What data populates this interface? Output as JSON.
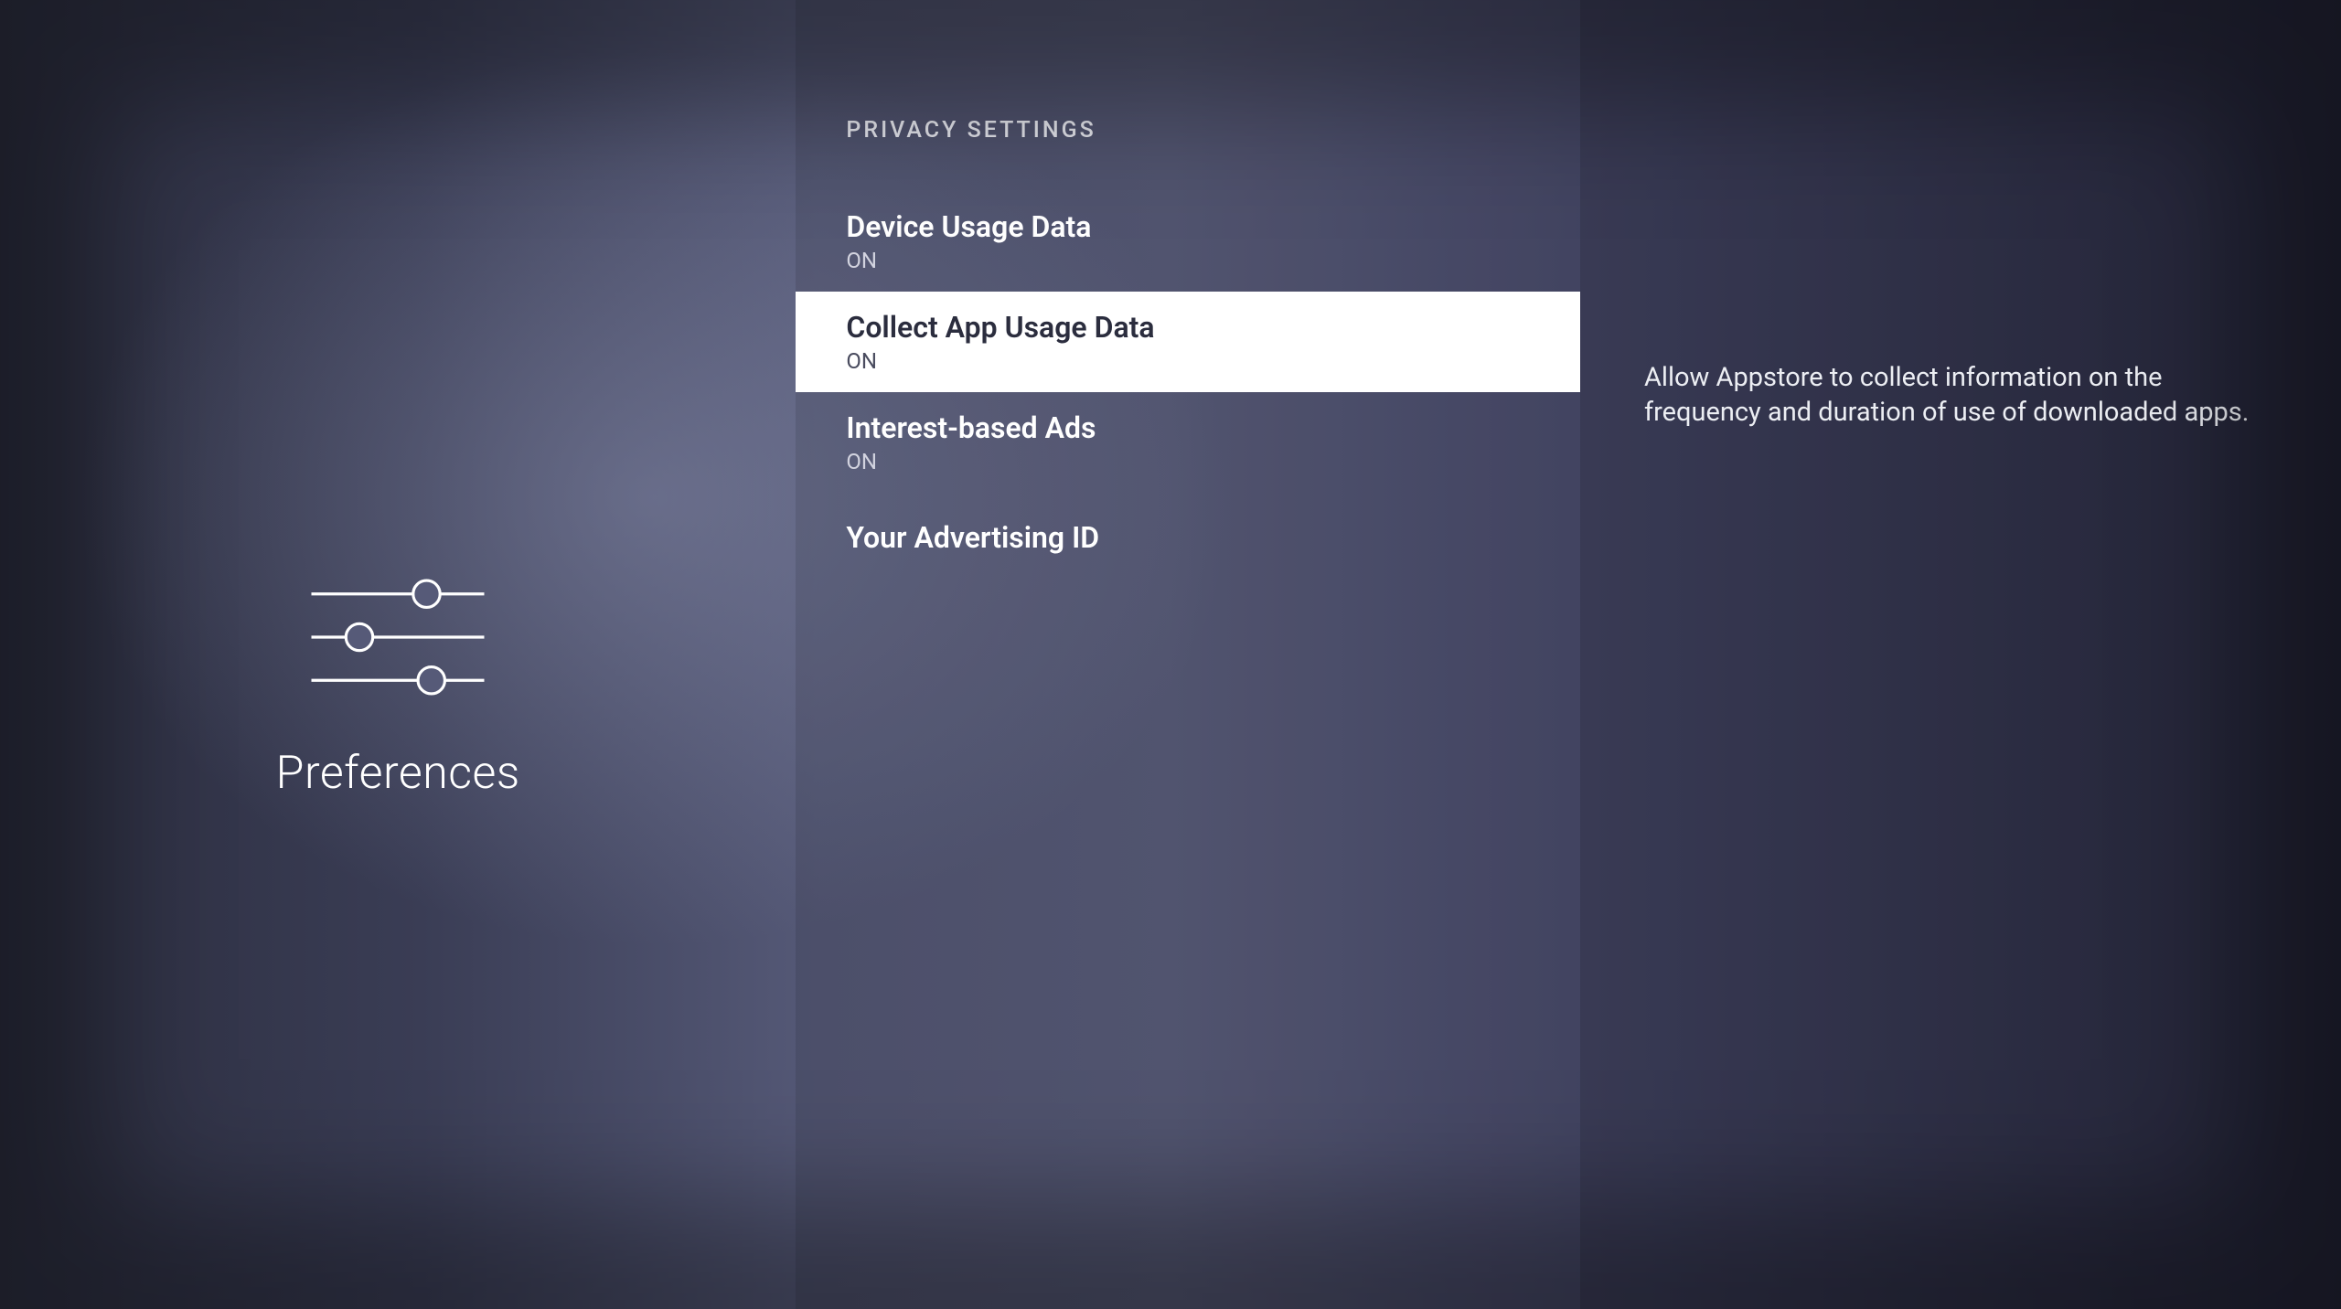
{
  "section": {
    "title": "Preferences"
  },
  "header": {
    "title": "PRIVACY SETTINGS"
  },
  "items": [
    {
      "title": "Device Usage Data",
      "status": "ON",
      "selected": false
    },
    {
      "title": "Collect App Usage Data",
      "status": "ON",
      "selected": true
    },
    {
      "title": "Interest-based Ads",
      "status": "ON",
      "selected": false
    },
    {
      "title": "Your Advertising ID",
      "status": null,
      "selected": false
    }
  ],
  "description": "Allow Appstore to collect information on the frequency and duration of use of downloaded apps."
}
